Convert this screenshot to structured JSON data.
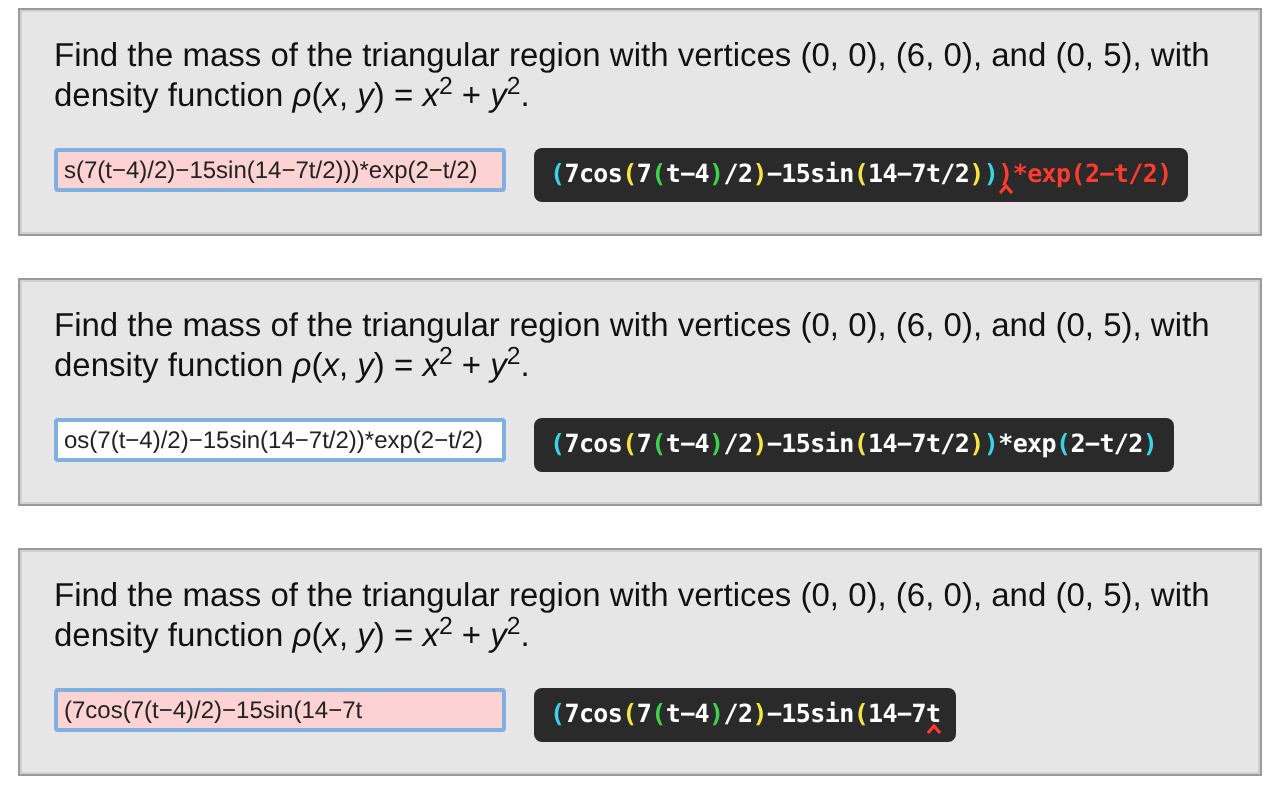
{
  "problems": [
    {
      "question": "Find the mass of the triangular region with vertices (0, 0), (6, 0), and (0, 5), with density function *ρ*(*x*, *y*) = *x*$^{2}$ + *y*$^{2}$.",
      "answer_value": "s(7(t−4)/2)−15sin(14−7t/2)))*exp(2−t/2)",
      "invalid": true,
      "preview": [
        {
          "text": "(",
          "color": "#3ad4e8",
          "error": false
        },
        {
          "text": "7cos",
          "color": "#ffffff",
          "error": false
        },
        {
          "text": "(",
          "color": "#f5e642",
          "error": false
        },
        {
          "text": "7",
          "color": "#ffffff",
          "error": false
        },
        {
          "text": "(",
          "color": "#3bd44a",
          "error": false
        },
        {
          "text": "t−4",
          "color": "#ffffff",
          "error": false
        },
        {
          "text": ")",
          "color": "#3bd44a",
          "error": false
        },
        {
          "text": "/2",
          "color": "#ffffff",
          "error": false
        },
        {
          "text": ")",
          "color": "#f5e642",
          "error": false
        },
        {
          "text": "−15sin",
          "color": "#ffffff",
          "error": false
        },
        {
          "text": "(",
          "color": "#f5e642",
          "error": false
        },
        {
          "text": "14−7t/2",
          "color": "#ffffff",
          "error": false
        },
        {
          "text": ")",
          "color": "#f5e642",
          "error": false
        },
        {
          "text": ")",
          "color": "#3ad4e8",
          "error": false
        },
        {
          "text": ")",
          "color": "#ff3b30",
          "error": true
        },
        {
          "text": "*exp(2−t/2)",
          "color": "#ff3b30",
          "error": false
        }
      ]
    },
    {
      "question": "Find the mass of the triangular region with vertices (0, 0), (6, 0), and (0, 5), with density function *ρ*(*x*, *y*) = *x*$^{2}$ + *y*$^{2}$.",
      "answer_value": "os(7(t−4)/2)−15sin(14−7t/2))*exp(2−t/2)",
      "invalid": false,
      "preview": [
        {
          "text": "(",
          "color": "#3ad4e8",
          "error": false
        },
        {
          "text": "7cos",
          "color": "#ffffff",
          "error": false
        },
        {
          "text": "(",
          "color": "#f5e642",
          "error": false
        },
        {
          "text": "7",
          "color": "#ffffff",
          "error": false
        },
        {
          "text": "(",
          "color": "#3bd44a",
          "error": false
        },
        {
          "text": "t−4",
          "color": "#ffffff",
          "error": false
        },
        {
          "text": ")",
          "color": "#3bd44a",
          "error": false
        },
        {
          "text": "/2",
          "color": "#ffffff",
          "error": false
        },
        {
          "text": ")",
          "color": "#f5e642",
          "error": false
        },
        {
          "text": "−15sin",
          "color": "#ffffff",
          "error": false
        },
        {
          "text": "(",
          "color": "#f5e642",
          "error": false
        },
        {
          "text": "14−7t/2",
          "color": "#ffffff",
          "error": false
        },
        {
          "text": ")",
          "color": "#f5e642",
          "error": false
        },
        {
          "text": ")",
          "color": "#3ad4e8",
          "error": false
        },
        {
          "text": "*exp",
          "color": "#ffffff",
          "error": false
        },
        {
          "text": "(",
          "color": "#3ad4e8",
          "error": false
        },
        {
          "text": "2−t/2",
          "color": "#ffffff",
          "error": false
        },
        {
          "text": ")",
          "color": "#3ad4e8",
          "error": false
        }
      ]
    },
    {
      "question": "Find the mass of the triangular region with vertices (0, 0), (6, 0), and (0, 5), with density function *ρ*(*x*, *y*) = *x*$^{2}$ + *y*$^{2}$.",
      "answer_value": "(7cos(7(t−4)/2)−15sin(14−7t",
      "invalid": true,
      "preview": [
        {
          "text": "(",
          "color": "#3ad4e8",
          "error": false
        },
        {
          "text": "7cos",
          "color": "#ffffff",
          "error": false
        },
        {
          "text": "(",
          "color": "#f5e642",
          "error": false
        },
        {
          "text": "7",
          "color": "#ffffff",
          "error": false
        },
        {
          "text": "(",
          "color": "#3bd44a",
          "error": false
        },
        {
          "text": "t−4",
          "color": "#ffffff",
          "error": false
        },
        {
          "text": ")",
          "color": "#3bd44a",
          "error": false
        },
        {
          "text": "/2",
          "color": "#ffffff",
          "error": false
        },
        {
          "text": ")",
          "color": "#f5e642",
          "error": false
        },
        {
          "text": "−15sin",
          "color": "#ffffff",
          "error": false
        },
        {
          "text": "(",
          "color": "#f5e642",
          "error": false
        },
        {
          "text": "14−7",
          "color": "#ffffff",
          "error": false
        },
        {
          "text": "t",
          "color": "#ffffff",
          "error": true
        }
      ]
    }
  ]
}
